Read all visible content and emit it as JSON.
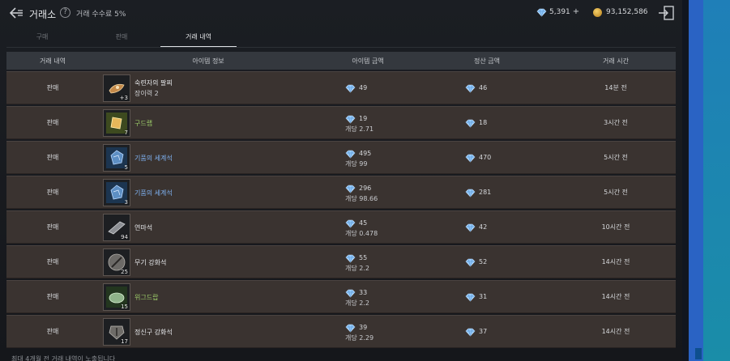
{
  "header": {
    "title": "거래소",
    "help": "?",
    "fee_text": "거래 수수료 5%",
    "gem_balance": "5,391",
    "plus": "+",
    "gold_balance": "93,152,586"
  },
  "tabs": [
    {
      "label": "구매",
      "active": false
    },
    {
      "label": "판매",
      "active": false
    },
    {
      "label": "거래 내역",
      "active": true
    }
  ],
  "table": {
    "columns": [
      "거래 내역",
      "아이템 정보",
      "아이템 금액",
      "정산 금액",
      "거래 시간"
    ],
    "rows": [
      {
        "type": "판매",
        "name": "숙련자의 팔찌",
        "name_sub": "장이력 2",
        "qty": "+3",
        "color": "white",
        "icon": "bracelet-icon",
        "price": "49",
        "unit": "",
        "settle": "46",
        "time": "14분 전"
      },
      {
        "type": "판매",
        "name": "구드랩",
        "name_sub": "",
        "qty": "7",
        "color": "green",
        "icon": "parchment-icon",
        "price": "19",
        "unit": "개당 2.71",
        "settle": "18",
        "time": "3시간 전"
      },
      {
        "type": "판매",
        "name": "기품의 세계석",
        "name_sub": "",
        "qty": "5",
        "color": "blue",
        "icon": "blue-stone-icon",
        "price": "495",
        "unit": "개당 99",
        "settle": "470",
        "time": "5시간 전"
      },
      {
        "type": "판매",
        "name": "기품의 세계석",
        "name_sub": "",
        "qty": "3",
        "color": "blue",
        "icon": "blue-stone-icon",
        "price": "296",
        "unit": "개당 98.66",
        "settle": "281",
        "time": "5시간 전"
      },
      {
        "type": "판매",
        "name": "연마석",
        "name_sub": "",
        "qty": "94",
        "color": "white",
        "icon": "whetstone-icon",
        "price": "45",
        "unit": "개당 0.478",
        "settle": "42",
        "time": "10시간 전"
      },
      {
        "type": "판매",
        "name": "무기 강화석",
        "name_sub": "",
        "qty": "25",
        "color": "white",
        "icon": "weapon-stone-icon",
        "price": "55",
        "unit": "개당 2.2",
        "settle": "52",
        "time": "14시간 전"
      },
      {
        "type": "판매",
        "name": "위그드랍",
        "name_sub": "",
        "qty": "15",
        "color": "green",
        "icon": "green-orb-icon",
        "price": "33",
        "unit": "개당 2.2",
        "settle": "31",
        "time": "14시간 전"
      },
      {
        "type": "판매",
        "name": "정신구 강화석",
        "name_sub": "",
        "qty": "17",
        "color": "white",
        "icon": "armor-stone-icon",
        "price": "39",
        "unit": "개당 2.29",
        "settle": "37",
        "time": "14시간 전"
      }
    ]
  },
  "footer": "최대 4개월 전 거래 내역이 노출됩니다",
  "colors": {
    "accent_gem": "#8ec8ff",
    "gold": "#d9a233",
    "name_green": "#9fcf6a",
    "name_blue": "#7fb2f2",
    "row_bg": "#3a3330"
  }
}
